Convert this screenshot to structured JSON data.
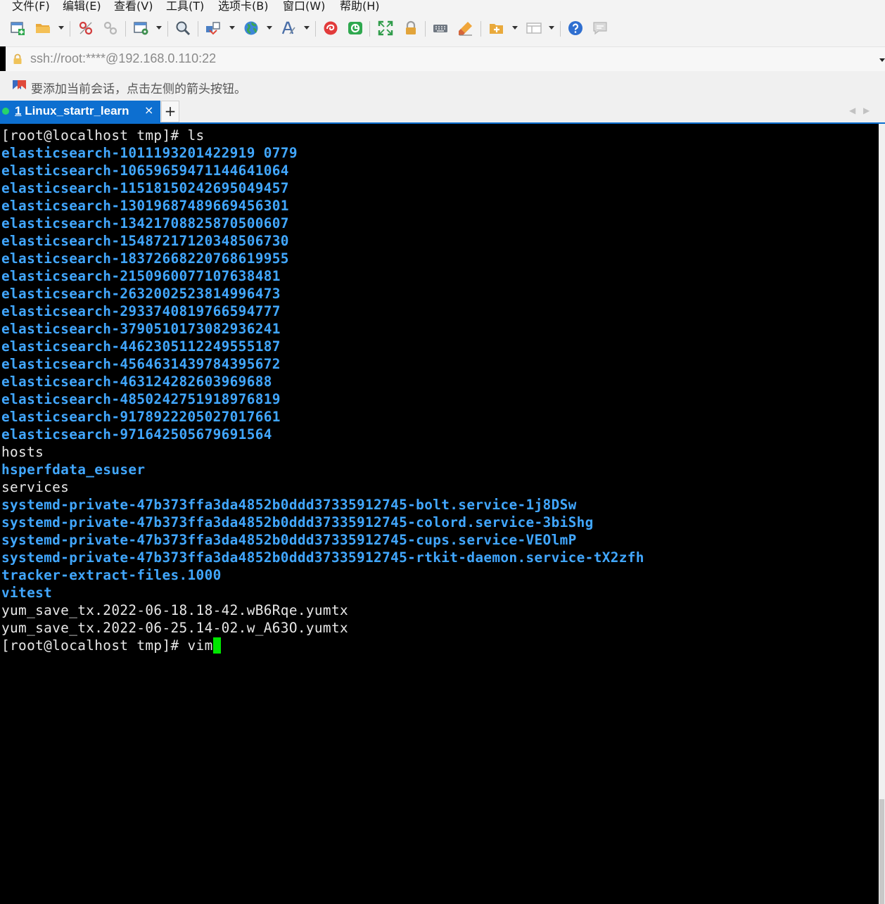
{
  "menu": [
    "文件(F)",
    "编辑(E)",
    "查看(V)",
    "工具(T)",
    "选项卡(B)",
    "窗口(W)",
    "帮助(H)"
  ],
  "toolbar_icons": [
    "new-session-icon",
    "open-folder-icon",
    "disconnect-icon",
    "reconnect-icon",
    "properties-icon",
    "find-icon",
    "transfer-icon",
    "globe-icon",
    "font-icon",
    "xshell-icon",
    "xftp-icon",
    "fullscreen-icon",
    "lock-icon",
    "keyboard-icon",
    "highlight-icon",
    "new-tab-icon",
    "layout-icon",
    "help-icon",
    "chat-icon"
  ],
  "address": {
    "text": "ssh://root:****@192.168.0.110:22"
  },
  "hint": {
    "text": "要添加当前会话，点击左侧的箭头按钮。"
  },
  "tabs": [
    {
      "number": "1",
      "label": "Linux_startr_learn",
      "close": "×"
    }
  ],
  "tab_add": "+",
  "colors": {
    "accent": "#0d6fd0",
    "dir": "#41a7ff",
    "plain": "#e8e8e8",
    "cursor": "#00e600",
    "connected": "#27d36b"
  },
  "terminal": {
    "lines": [
      {
        "text": "[root@localhost tmp]# ls",
        "type": "plain"
      },
      {
        "text": "elasticsearch-1011193201422919 0779",
        "type": "dir"
      },
      {
        "text": "elasticsearch-10659659471144641064",
        "type": "dir"
      },
      {
        "text": "elasticsearch-11518150242695049457",
        "type": "dir"
      },
      {
        "text": "elasticsearch-13019687489669456301",
        "type": "dir"
      },
      {
        "text": "elasticsearch-13421708825870500607",
        "type": "dir"
      },
      {
        "text": "elasticsearch-15487217120348506730",
        "type": "dir"
      },
      {
        "text": "elasticsearch-18372668220768619955",
        "type": "dir"
      },
      {
        "text": "elasticsearch-2150960077107638481",
        "type": "dir"
      },
      {
        "text": "elasticsearch-2632002523814996473",
        "type": "dir"
      },
      {
        "text": "elasticsearch-2933740819766594777",
        "type": "dir"
      },
      {
        "text": "elasticsearch-3790510173082936241",
        "type": "dir"
      },
      {
        "text": "elasticsearch-4462305112249555187",
        "type": "dir"
      },
      {
        "text": "elasticsearch-4564631439784395672",
        "type": "dir"
      },
      {
        "text": "elasticsearch-463124282603969688",
        "type": "dir"
      },
      {
        "text": "elasticsearch-4850242751918976819",
        "type": "dir"
      },
      {
        "text": "elasticsearch-9178922205027017661",
        "type": "dir"
      },
      {
        "text": "elasticsearch-971642505679691564",
        "type": "dir"
      },
      {
        "text": "hosts",
        "type": "plain"
      },
      {
        "text": "hsperfdata_esuser",
        "type": "dir"
      },
      {
        "text": "services",
        "type": "plain"
      },
      {
        "text": "systemd-private-47b373ffa3da4852b0ddd37335912745-bolt.service-1j8DSw",
        "type": "dir"
      },
      {
        "text": "systemd-private-47b373ffa3da4852b0ddd37335912745-colord.service-3biShg",
        "type": "dir"
      },
      {
        "text": "systemd-private-47b373ffa3da4852b0ddd37335912745-cups.service-VEOlmP",
        "type": "dir"
      },
      {
        "text": "systemd-private-47b373ffa3da4852b0ddd37335912745-rtkit-daemon.service-tX2zfh",
        "type": "dir"
      },
      {
        "text": "tracker-extract-files.1000",
        "type": "dir"
      },
      {
        "text": "vitest",
        "type": "dir"
      },
      {
        "text": "yum_save_tx.2022-06-18.18-42.wB6Rqe.yumtx",
        "type": "plain"
      },
      {
        "text": "yum_save_tx.2022-06-25.14-02.w_A63O.yumtx",
        "type": "plain"
      },
      {
        "text": "[root@localhost tmp]# vim",
        "type": "plain",
        "cursor": true
      }
    ]
  }
}
